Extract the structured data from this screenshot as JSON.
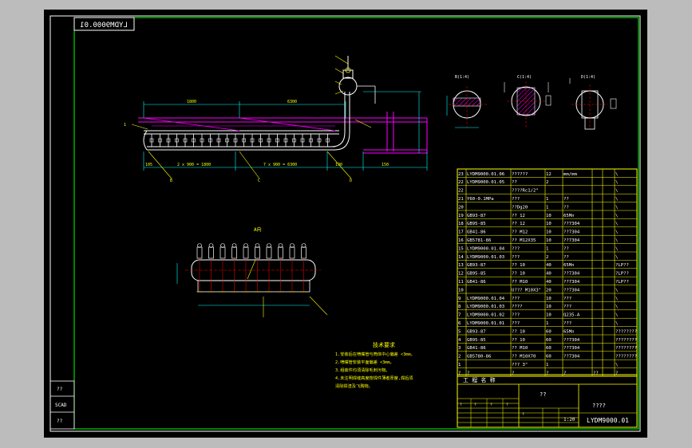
{
  "drawing": {
    "code_box": "LYDM9000.01",
    "left_strip": [
      "??",
      "SCAD",
      "??"
    ],
    "section_labels": [
      "B(1:4)",
      "C(1:4)",
      "D(1:4)"
    ],
    "plan_label": "A向",
    "notes_title": "技术要求",
    "notes": [
      "1.安装后在喷嘴管与筒体中心偏差 <3mm。",
      "2.喷嘴管安装平面偏差 <3mm。",
      "3.组装件均须清除毛刺污物。",
      "4.未注明焊缝高度按焊件薄者厚度,焊后须",
      "清除焊渣及飞溅物。"
    ],
    "dims": [
      "105",
      "2 x 900 = 1800",
      "7 x 900 = 6300",
      "190",
      "150"
    ]
  },
  "bom": {
    "rows": [
      {
        "no": "23",
        "code": "LYDM9000.01.06",
        "name": "??????",
        "qty": "12",
        "mat": "mm/mm",
        "wt": "",
        "note": "\\"
      },
      {
        "no": "22",
        "code": "LYDM9000.01.05",
        "name": "??",
        "qty": "2",
        "mat": "",
        "wt": "",
        "note": "\\"
      },
      {
        "no": "22",
        "code": "",
        "name": "????Rc1/2\"",
        "qty": "",
        "mat": "",
        "wt": "",
        "note": "\\"
      },
      {
        "no": "21",
        "code": "Y60-0.1MPa",
        "name": "???",
        "qty": "1",
        "mat": "??",
        "wt": "",
        "note": "\\"
      },
      {
        "no": "20",
        "code": "",
        "name": "??Dg20",
        "qty": "1",
        "mat": "??",
        "wt": "",
        "note": "\\"
      },
      {
        "no": "19",
        "code": "GB93-87",
        "name": "?? 12",
        "qty": "10",
        "mat": "65Mn",
        "wt": "",
        "note": "\\"
      },
      {
        "no": "18",
        "code": "GB95-85",
        "name": "?? 12",
        "qty": "10",
        "mat": "??7304",
        "wt": "",
        "note": "\\"
      },
      {
        "no": "17",
        "code": "GB41-86",
        "name": "?? M12",
        "qty": "10",
        "mat": "??7304",
        "wt": "",
        "note": "\\"
      },
      {
        "no": "16",
        "code": "GB5781-86",
        "name": "?? M12X35",
        "qty": "10",
        "mat": "??7304",
        "wt": "",
        "note": "\\"
      },
      {
        "no": "15",
        "code": "LYDM9000.01.04",
        "name": "???",
        "qty": "1",
        "mat": "??",
        "wt": "",
        "note": "\\"
      },
      {
        "no": "14",
        "code": "LYDM9000.01.03",
        "name": "???",
        "qty": "2",
        "mat": "??",
        "wt": "",
        "note": "\\"
      },
      {
        "no": "13",
        "code": "GB93-87",
        "name": "?? 10",
        "qty": "40",
        "mat": "65Mn",
        "wt": "",
        "note": "?LP??"
      },
      {
        "no": "12",
        "code": "GB95-85",
        "name": "?? 10",
        "qty": "40",
        "mat": "??7304",
        "wt": "",
        "note": "?LP??"
      },
      {
        "no": "11",
        "code": "GB41-86",
        "name": "?? M10",
        "qty": "40",
        "mat": "??7304",
        "wt": "",
        "note": "?LP??"
      },
      {
        "no": "10",
        "code": "",
        "name": "U??? M10X3\"",
        "qty": "20",
        "mat": "??7304",
        "wt": "",
        "note": "\\"
      },
      {
        "no": "9",
        "code": "LYDM9000.01.04",
        "name": "???",
        "qty": "10",
        "mat": "???",
        "wt": "",
        "note": "\\"
      },
      {
        "no": "8",
        "code": "LYDM9000.01.03",
        "name": "????",
        "qty": "10",
        "mat": "???",
        "wt": "",
        "note": "\\"
      },
      {
        "no": "7",
        "code": "LYDM9000.01.02",
        "name": "???",
        "qty": "10",
        "mat": "Q235-A",
        "wt": "",
        "note": "\\"
      },
      {
        "no": "6",
        "code": "LYDM9000.01.01",
        "name": "???",
        "qty": "1",
        "mat": "???",
        "wt": "",
        "note": "\\"
      },
      {
        "no": "5",
        "code": "GB93-87",
        "name": "?? 10",
        "qty": "60",
        "mat": "65Mn",
        "wt": "",
        "note": "????????"
      },
      {
        "no": "4",
        "code": "GB95-85",
        "name": "?? 10",
        "qty": "60",
        "mat": "??7304",
        "wt": "",
        "note": "????????"
      },
      {
        "no": "3",
        "code": "GB41-86",
        "name": "?? M10",
        "qty": "60",
        "mat": "??7304",
        "wt": "",
        "note": "????????"
      },
      {
        "no": "2",
        "code": "GB5780-86",
        "name": "?? M10X70",
        "qty": "60",
        "mat": "??7304",
        "wt": "",
        "note": "????????"
      },
      {
        "no": "1",
        "code": "",
        "name": "??? 3\"",
        "qty": "1",
        "mat": "",
        "wt": "",
        "note": "\\"
      }
    ],
    "header": {
      "no": "?",
      "code": "?",
      "name": "?",
      "qty": "?",
      "mat": "?",
      "wt": "??",
      "note": "?"
    }
  },
  "title_block": {
    "firm": "工 程 名 称",
    "part_name": "??",
    "project": "????",
    "scale": "1:20",
    "drawing_no": "LYDM9000.01",
    "grid_marks": [
      "?",
      "?",
      "?",
      "?",
      "?"
    ]
  },
  "colors": {
    "background": "#000000",
    "outer": "#bcbcbc",
    "frame": "#00ff00",
    "white": "#ffffff",
    "cyan": "#00ffff",
    "yellow": "#ffff00",
    "magenta": "#ff00ff",
    "red": "#ff0000"
  }
}
